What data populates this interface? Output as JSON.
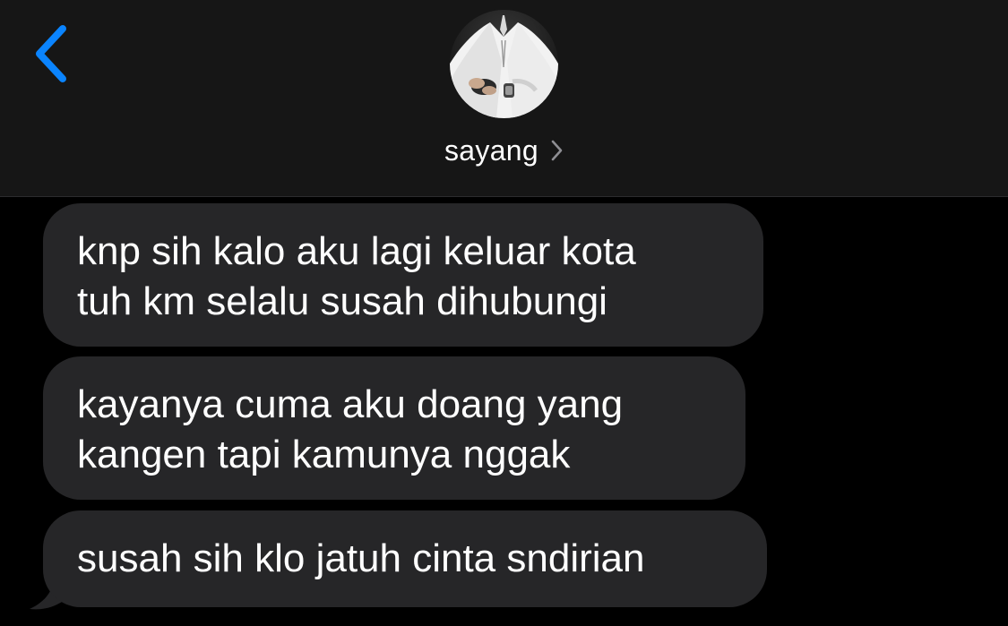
{
  "header": {
    "contact_name": "sayang",
    "back_icon": "chevron-left-icon",
    "detail_icon": "chevron-right-icon",
    "avatar": "contact-photo"
  },
  "messages": [
    {
      "direction": "incoming",
      "lines": [
        "knp sih kalo aku lagi keluar kota",
        "tuh km selalu susah dihubungi"
      ]
    },
    {
      "direction": "incoming",
      "lines": [
        "kayanya cuma aku doang yang",
        "kangen tapi kamunya nggak"
      ]
    },
    {
      "direction": "incoming",
      "lines": [
        "susah sih klo jatuh cinta sndirian"
      ]
    }
  ],
  "colors": {
    "header_bg": "#161616",
    "chat_bg": "#000000",
    "incoming_bubble": "#262628",
    "accent_blue": "#0a84ff",
    "text": "#ffffff"
  }
}
